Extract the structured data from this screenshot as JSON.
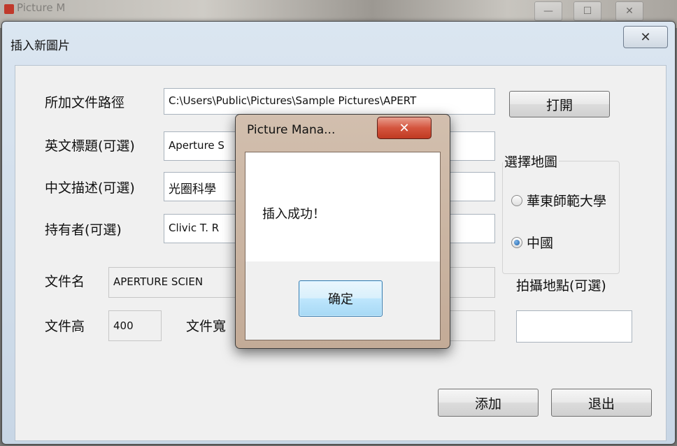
{
  "background_window": {
    "title": "Picture M",
    "controls": [
      "—",
      "☐",
      "✕"
    ]
  },
  "dialog": {
    "title": "插入新圖片",
    "close_glyph": "✕"
  },
  "form": {
    "path_label": "所加文件路徑",
    "path_value": "C:\\Users\\Public\\Pictures\\Sample Pictures\\APERT",
    "open_button": "打開",
    "en_title_label": "英文標題(可選)",
    "en_title_value": "Aperture S",
    "cn_desc_label": "中文描述(可選)",
    "cn_desc_value": "光圈科學",
    "owner_label": "持有者(可選)",
    "owner_value": "Clivic T. R",
    "filename_label": "文件名",
    "filename_value": "APERTURE SCIEN",
    "height_label": "文件高",
    "height_value": "400",
    "width_label": "文件寬",
    "width_value": "",
    "map_group_title": "選擇地圖",
    "map_options": [
      {
        "label": "華東師範大學",
        "selected": false
      },
      {
        "label": "中國",
        "selected": true
      }
    ],
    "location_label": "拍攝地點(可選)",
    "location_value": "",
    "add_button": "添加",
    "exit_button": "退出"
  },
  "message_box": {
    "title": "Picture Mana...",
    "close_glyph": "✕",
    "message": "插入成功！",
    "ok_button": "确定"
  }
}
